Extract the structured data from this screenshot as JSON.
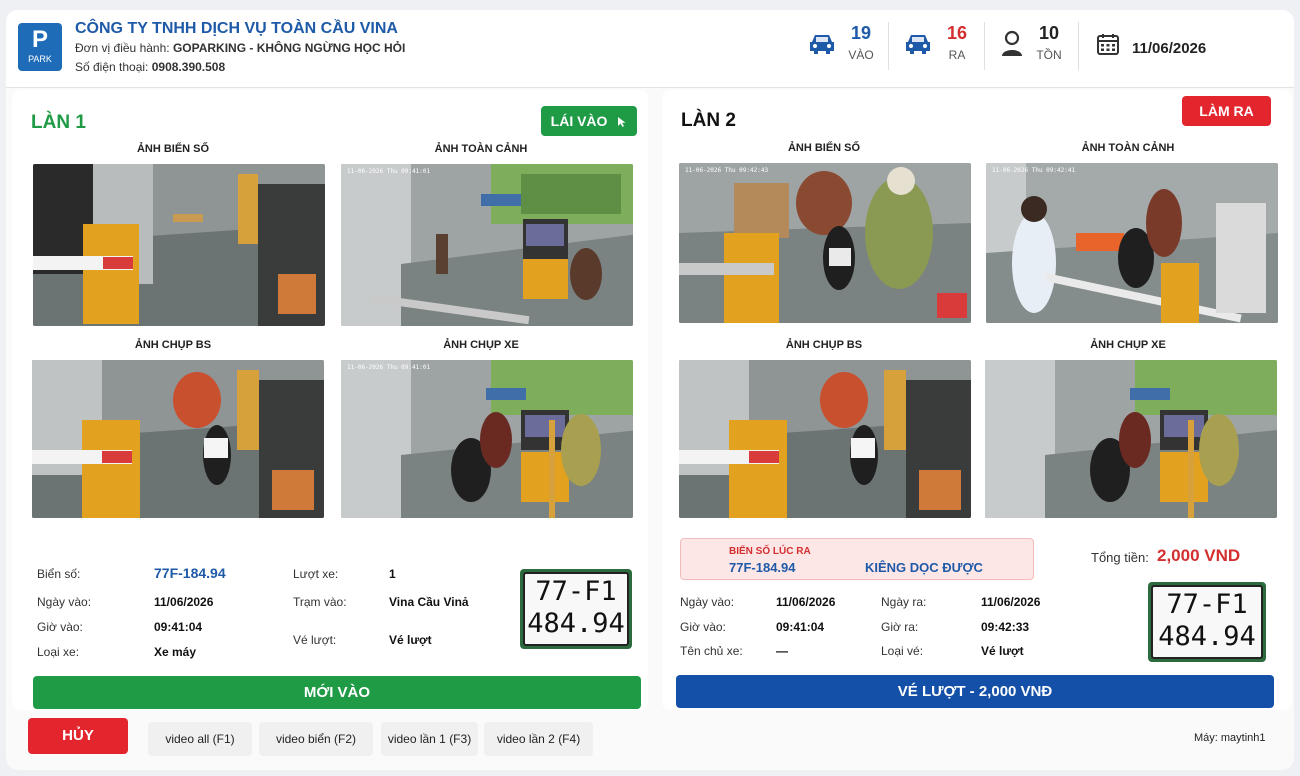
{
  "header": {
    "logo_letter": "P",
    "logo_sub": "PARK",
    "company": "CÔNG TY TNHH DỊCH VỤ TOÀN CẦU VINA",
    "operator_label": "Đơn vị điều hành:",
    "operator_value": "GOPARKING - KHÔNG NGỪNG HỌC HỎI",
    "phone_label": "Số điện thoại:",
    "phone_value": "0908.390.508",
    "stats": {
      "in": {
        "value": "19",
        "label": "VÀO",
        "color": "#1e5aa8"
      },
      "out": {
        "value": "16",
        "label": "RA",
        "color": "#d32f2f"
      },
      "stock": {
        "value": "10",
        "label": "TỒN",
        "color": "#222222"
      }
    },
    "date": "11/06/2026"
  },
  "lane1": {
    "title": "LÀN 1",
    "action_button": "LÁI VÀO",
    "captions": [
      "ẢNH BIỂN SỐ",
      "ẢNH TOÀN CẢNH",
      "ẢNH CHỤP BS",
      "ẢNH CHỤP XE"
    ],
    "cam_timestamps": [
      "11-06-2026  Thu  09:41:01",
      "11-06-2026  Thu  09:41:01"
    ],
    "fields": {
      "plate_label": "Biển số:",
      "plate_value": "77F-184.94",
      "entry_date_label": "Ngày vào:",
      "entry_date_value": "11/06/2026",
      "entry_time_label": "Giờ vào:",
      "entry_time_value": "09:41:04",
      "vehicle_type_label": "Loại xe:",
      "vehicle_type_value": "Xe máy",
      "turn_label": "Lượt xe:",
      "turn_value": "1",
      "station_label": "Trạm vào:",
      "station_value": "Vina Cầu Vinả",
      "ticket_label": "Vé lượt:",
      "ticket_value": "Vé lượt"
    },
    "plate_image": {
      "line1": "77-F1",
      "line2": "484.94"
    },
    "status_bar": "MỚI VÀO"
  },
  "lane2": {
    "title": "LÀN 2",
    "action_button": "LÀM RA",
    "captions": [
      "ẢNH BIỂN SỐ",
      "ẢNH TOÀN CẢNH",
      "ẢNH CHỤP BS",
      "ẢNH CHỤP XE"
    ],
    "cam_timestamps": [
      "11-06-2026  Thu  09:42:43",
      "11-06-2026  Thu  09:42:41"
    ],
    "exit_plate_label": "BIỂN SỐ LÚC RA",
    "exit_plate_value": "77F-184.94",
    "exit_note": "KIÊNG DỌC ĐƯỢC",
    "total_label": "Tổng tiền:",
    "total_value": "2,000 VND",
    "fields": {
      "entry_date_label": "Ngày vào:",
      "entry_date_value": "11/06/2026",
      "entry_time_label": "Giờ vào:",
      "entry_time_value": "09:41:04",
      "owner_label": "Tên chủ xe:",
      "owner_value": "—",
      "exit_date_label": "Ngày ra:",
      "exit_date_value": "11/06/2026",
      "exit_time_label": "Giờ ra:",
      "exit_time_value": "09:42:33",
      "ticket_type_label": "Loại vé:",
      "ticket_type_value": "Vé lượt"
    },
    "plate_image": {
      "line1": "77-F1",
      "line2": "484.94"
    },
    "status_bar": "VÉ LƯỢT - 2,000 VNĐ"
  },
  "footer": {
    "cancel": "HỦY",
    "video_buttons": [
      "video all (F1)",
      "video biển (F2)",
      "video lần 1 (F3)",
      "video lần 2 (F4)"
    ],
    "machine": "Máy: maytinh1"
  },
  "colors": {
    "brand_blue": "#1e5aa8",
    "green": "#1f9a45",
    "red": "#e3252e",
    "navy": "#1450a8"
  },
  "icons": [
    "motorbike-icon",
    "person-icon",
    "calendar-icon",
    "cursor-icon"
  ]
}
